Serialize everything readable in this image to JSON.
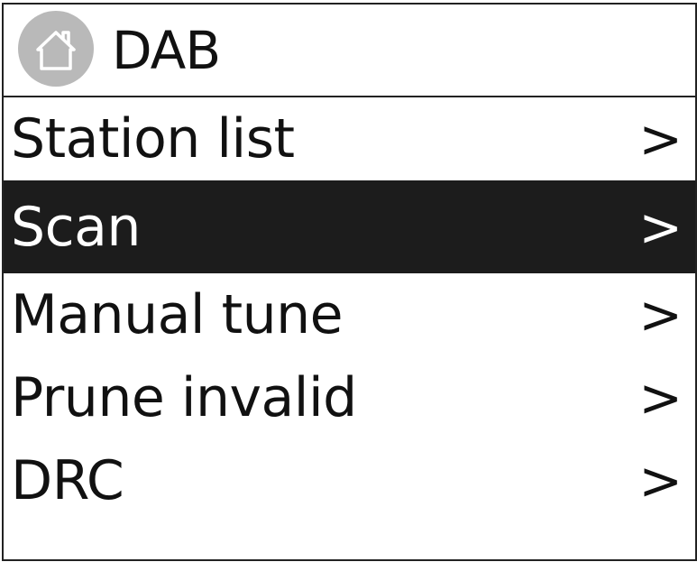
{
  "header": {
    "title": "DAB",
    "icon": "home-icon"
  },
  "menu": {
    "items": [
      {
        "label": "Station list",
        "chevron": ">",
        "selected": false
      },
      {
        "label": "Scan",
        "chevron": ">",
        "selected": true
      },
      {
        "label": "Manual tune",
        "chevron": ">",
        "selected": false
      },
      {
        "label": "Prune invalid",
        "chevron": ">",
        "selected": false
      },
      {
        "label": "DRC",
        "chevron": ">",
        "selected": false
      }
    ]
  },
  "colors": {
    "highlight_background": "#1c1c1c",
    "highlight_text": "#ffffff",
    "home_circle": "#b9b9b9",
    "text": "#111111"
  }
}
